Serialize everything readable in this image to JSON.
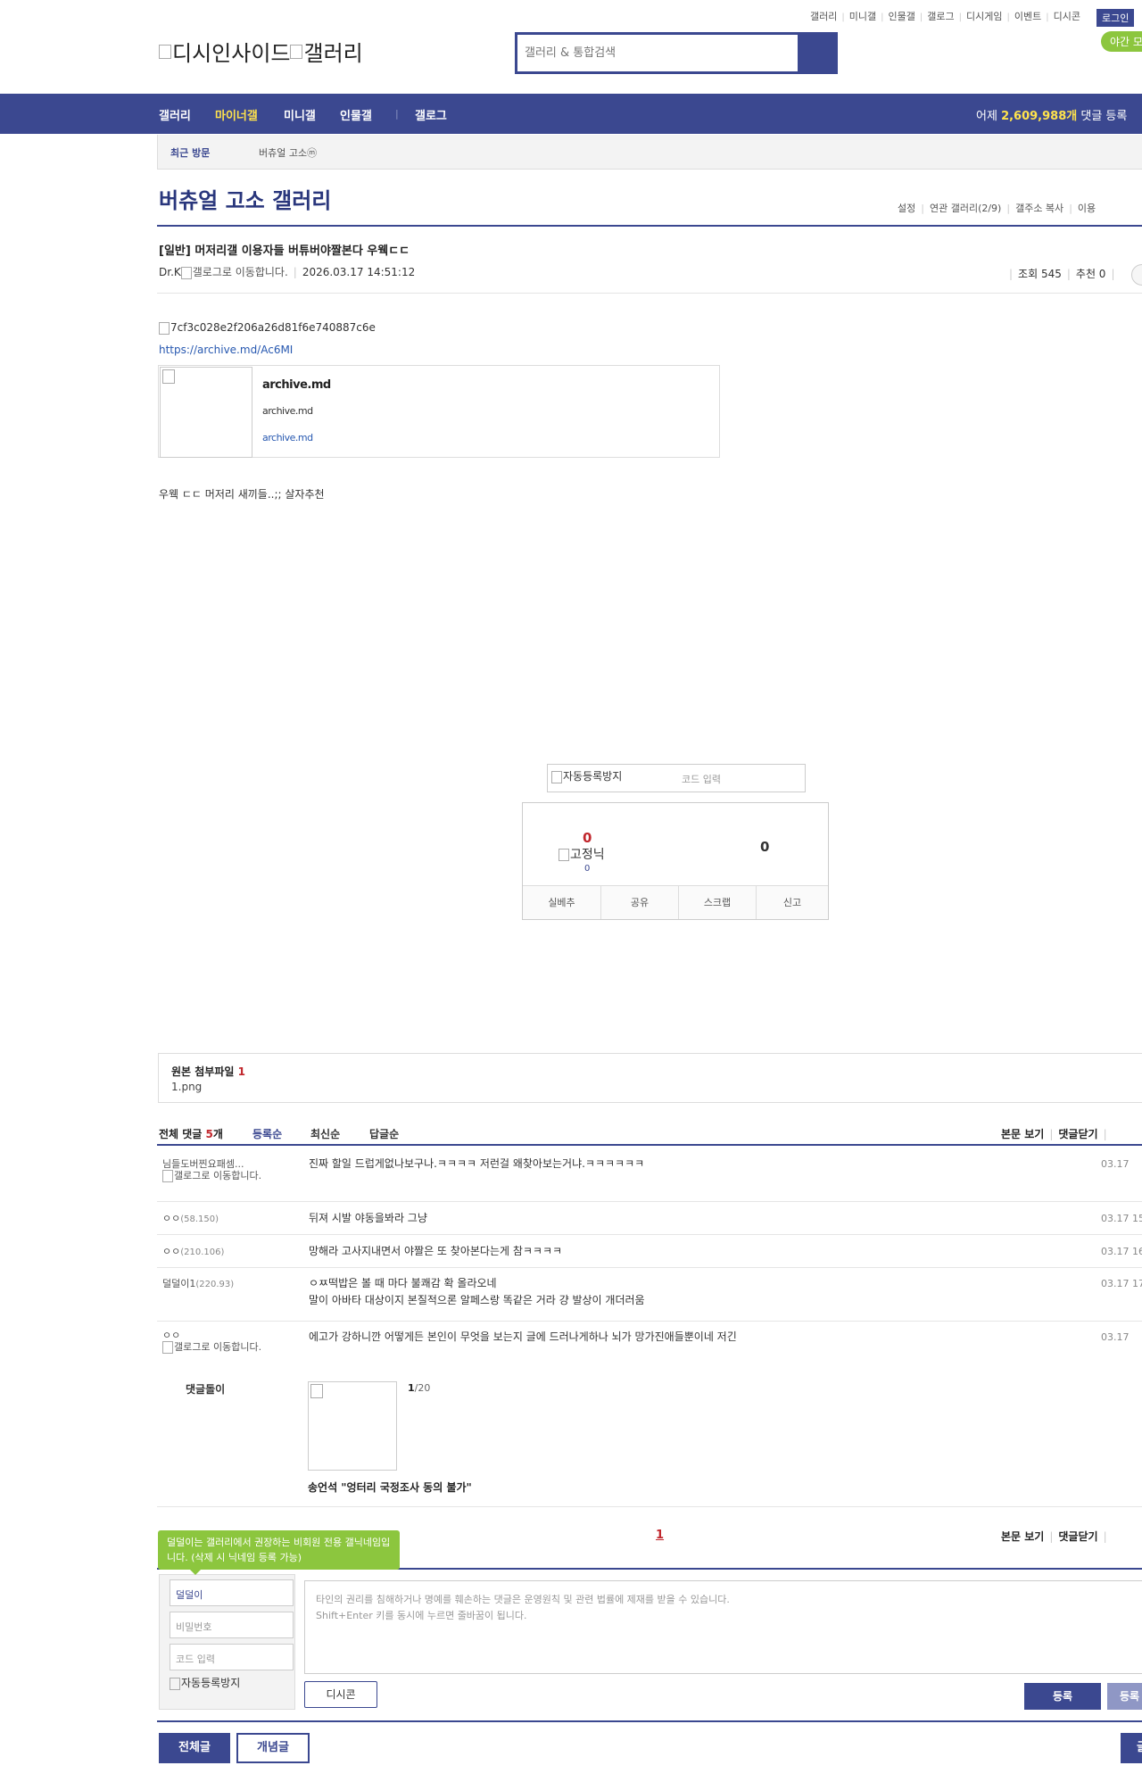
{
  "header": {
    "top_links": [
      "갤러리",
      "미니갤",
      "인물갤",
      "갤로그",
      "디시게임",
      "이벤트",
      "디시콘"
    ],
    "login_label": "로그인",
    "night_mode_label": "야간 모",
    "logo_alt_1": "디시인사이드",
    "logo_alt_2": "갤러리",
    "search_placeholder": "갤러리 & 통합검색"
  },
  "nav": {
    "items": [
      "갤러리",
      "마이너갤",
      "미니갤",
      "인물갤",
      "갤로그"
    ],
    "active_index": 1,
    "yesterday_prefix": "어제",
    "yesterday_count": "2,609,988개",
    "yesterday_suffix": "댓글 등록"
  },
  "recent": {
    "title": "최근 방문",
    "item": "버츄얼 고소ⓜ"
  },
  "gallery": {
    "title": "버츄얼 고소 갤러리",
    "links": [
      "설정",
      "연관 갤러리(2/9)",
      "갤주소 복사",
      "이용"
    ]
  },
  "post": {
    "title": "[일반] 머저리갤 이용자들 버튜버야짤본다 우웩ㄷㄷ",
    "author": "Dr.K",
    "author_gallog_alt": "갤로그로 이동합니다.",
    "date": "2026.03.17 14:51:12",
    "views_label": "조회 545",
    "recommend_label": "추천 0",
    "image_alt": "7cf3c028e2f206a26d81f6e740887c6e",
    "link": "https://archive.md/Ac6MI",
    "og_title": "archive.md",
    "og_desc": "archive.md",
    "og_url": "archive.md",
    "body_text": "우웩 ㄷㄷ 머저리 새끼들..;; 살자추천"
  },
  "vote": {
    "captcha_alt": "자동등록방지",
    "captcha_placeholder": "코드 입력",
    "up_count": "0",
    "fixed_alt": "고정닉",
    "fixed_count": "0",
    "down_count": "0",
    "buttons": [
      "실베추",
      "공유",
      "스크랩",
      "신고"
    ]
  },
  "attachment": {
    "title": "원본 첨부파일",
    "count": "1",
    "file": "1.png"
  },
  "comments": {
    "total_label": "전체 댓글",
    "total_count": "5",
    "total_unit": "개",
    "sorts": [
      "등록순",
      "최신순",
      "답글순"
    ],
    "right_links": [
      "본문 보기",
      "댓글닫기"
    ],
    "items": [
      {
        "nick": "님들도버찐요패셈...",
        "ip": "",
        "gallog": "갤로그로 이동합니다.",
        "text": [
          "진짜 할일 드럽게없나보구나.ㅋㅋㅋㅋ 저런걸 왜찾아보는거냐.ㅋㅋㅋㅋㅋㅋ"
        ],
        "date": "03.17"
      },
      {
        "nick": "ㅇㅇ",
        "ip": "(58.150)",
        "gallog": "",
        "text": [
          "뒤져 시발 야동을봐라 그냥"
        ],
        "date": "03.17 15"
      },
      {
        "nick": "ㅇㅇ",
        "ip": "(210.106)",
        "gallog": "",
        "text": [
          "망해라 고사지내면서 야짤은 또 찾아본다는게 참ㅋㅋㅋㅋ"
        ],
        "date": "03.17 16"
      },
      {
        "nick": "덜덜이1",
        "ip": "(220.93)",
        "gallog": "",
        "text": [
          "ㅇㅉ떡밥은 볼 때 마다 불쾌감 확 올라오네",
          "말이 아바타 대상이지 본질적으론 알페스랑 똑같은 거라 걍 발상이 개더러움"
        ],
        "date": "03.17 17"
      },
      {
        "nick": "ㅇㅇ",
        "ip": "",
        "gallog": "갤로그로 이동합니다.",
        "text": [
          "에고가 강하니깐 어떻게든 본인이 무엇을 보는지 글에 드러나게하나 뇌가 망가진애들뿐이네 저긴"
        ],
        "date": "03.17"
      }
    ],
    "dory_label": "댓글돌이",
    "dory_page": "1",
    "dory_total": "/20",
    "dory_title": "송언석 \"엉터리 국정조사 동의 불가\"",
    "pager": "1"
  },
  "write": {
    "tooltip": "덜덜이는 갤러리에서 권장하는 비회원 전용 갤닉네임입니다. (삭제 시 닉네임 등록 가능)",
    "nick_value": "덜덜이",
    "password_placeholder": "비밀번호",
    "code_placeholder": "코드 입력",
    "captcha_alt": "자동등록방지",
    "textarea_line1": "타인의 권리를 침해하거나 명예를 훼손하는 댓글은 운영원칙 및 관련 법률에 제재를 받을 수 있습니다.",
    "textarea_line2": "Shift+Enter 키를 동시에 누르면 줄바꿈이 됩니다.",
    "dccon_label": "디시콘",
    "submit_label": "등록",
    "submit2_label": "등록"
  },
  "bottom": {
    "all_label": "전체글",
    "concept_label": "개념글",
    "write_label": "글"
  }
}
